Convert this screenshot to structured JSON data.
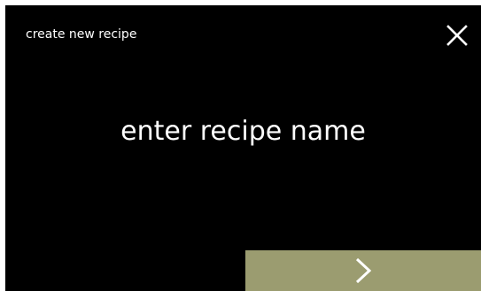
{
  "screen": {
    "title": "create new recipe",
    "prompt": "enter recipe name"
  },
  "controls": {
    "close_icon": "close-icon",
    "next_icon": "chevron-right-icon"
  },
  "colors": {
    "background": "#000000",
    "text": "#ffffff",
    "accent": "#9b9c70"
  }
}
